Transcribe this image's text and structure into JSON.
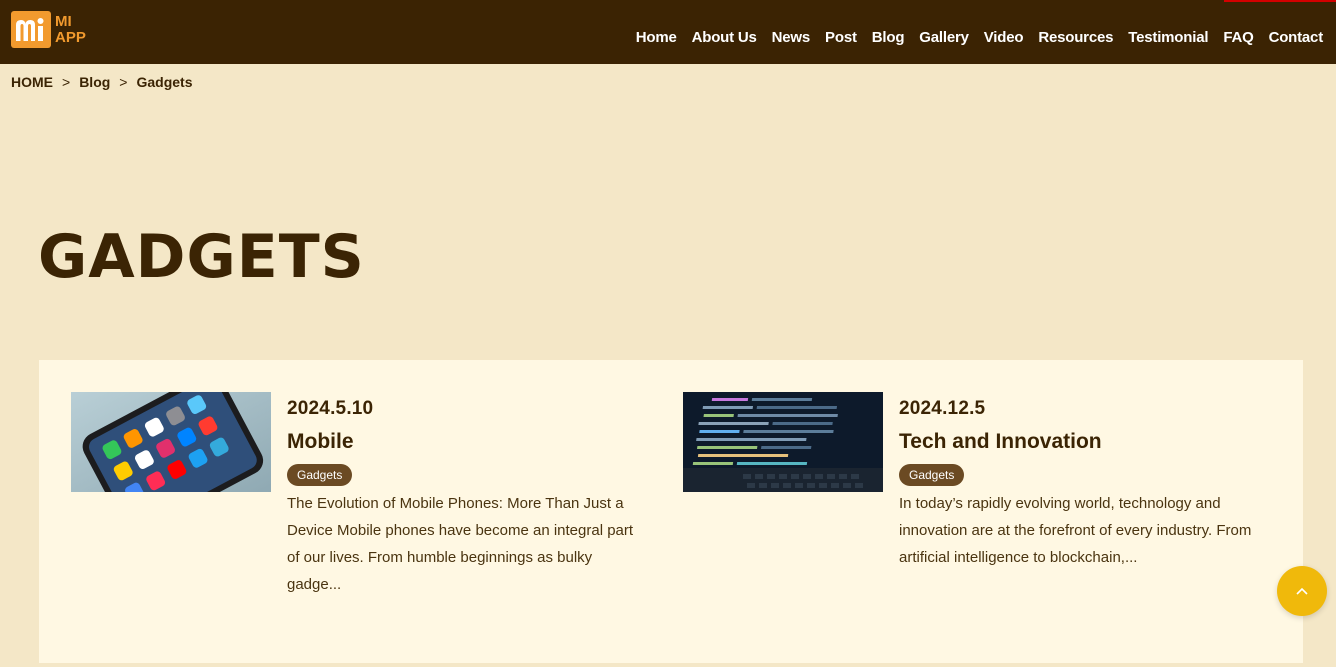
{
  "logo": {
    "line1": "MI",
    "line2": "APP"
  },
  "nav": [
    "Home",
    "About Us",
    "News",
    "Post",
    "Blog",
    "Gallery",
    "Video",
    "Resources",
    "Testimonial",
    "FAQ",
    "Contact"
  ],
  "breadcrumb": {
    "home": "HOME",
    "sep": ">",
    "blog": "Blog",
    "current": "Gadgets"
  },
  "page_title": "GADGETS",
  "posts": [
    {
      "date": "2024.5.10",
      "title": "Mobile",
      "tag": "Gadgets",
      "excerpt": "The Evolution of Mobile Phones: More Than Just a Device Mobile phones have become an integral part of our lives. From humble beginnings as bulky gadge...",
      "thumb_icon": "smartphone-photo"
    },
    {
      "date": "2024.12.5",
      "title": "Tech and Innovation",
      "tag": "Gadgets",
      "excerpt": "In today’s rapidly evolving world, technology and innovation are at the forefront of every industry. From artificial intelligence to blockchain,...",
      "thumb_icon": "laptop-code-photo"
    }
  ],
  "colors": {
    "header_bg": "#3b2303",
    "page_bg": "#f4e7c7",
    "card_bg": "#fff8e3",
    "brand_orange": "#f29a2e",
    "tag_bg": "#6b4a23",
    "scroll_button": "#f0b90b"
  }
}
